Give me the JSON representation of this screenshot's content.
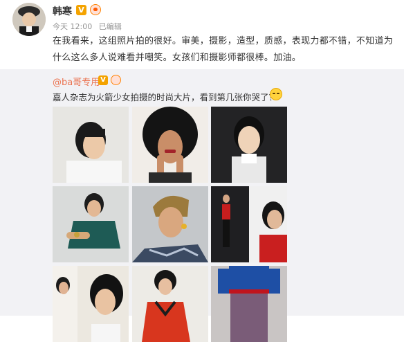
{
  "post": {
    "author": "韩寒",
    "verified_badge": "V",
    "badge_icon": "fan-heart-icon",
    "time": "今天 12:00",
    "edited": "已编辑",
    "text": "在我看来，这组照片拍的很好。审美，摄影，造型，质感，表现力都不错，不知道为什么这么多人说难看并嘲笑。女孩们和摄影师都很棒。加油。"
  },
  "repost": {
    "author": "@ba哥专用",
    "verified_badge": "V",
    "text": "嘉人杂志为火箭少女拍摄的时尚大片，看到第几张你哭了？",
    "emoji": "crying-emoji",
    "photos": [
      {
        "icon": "photo-portrait-short-hair"
      },
      {
        "icon": "photo-portrait-curly-hair"
      },
      {
        "icon": "photo-portrait-dark-background"
      },
      {
        "icon": "photo-portrait-green-dress"
      },
      {
        "icon": "photo-portrait-blonde-undercut"
      },
      {
        "icon": "photo-portrait-red-top-collage"
      },
      {
        "icon": "photo-portrait-two-women"
      },
      {
        "icon": "photo-portrait-red-jacket"
      },
      {
        "icon": "photo-portrait-blue-sweater"
      }
    ]
  },
  "colors": {
    "link": "#eb7350",
    "repost_bg": "#f2f2f5",
    "badge": "#f4a300"
  }
}
